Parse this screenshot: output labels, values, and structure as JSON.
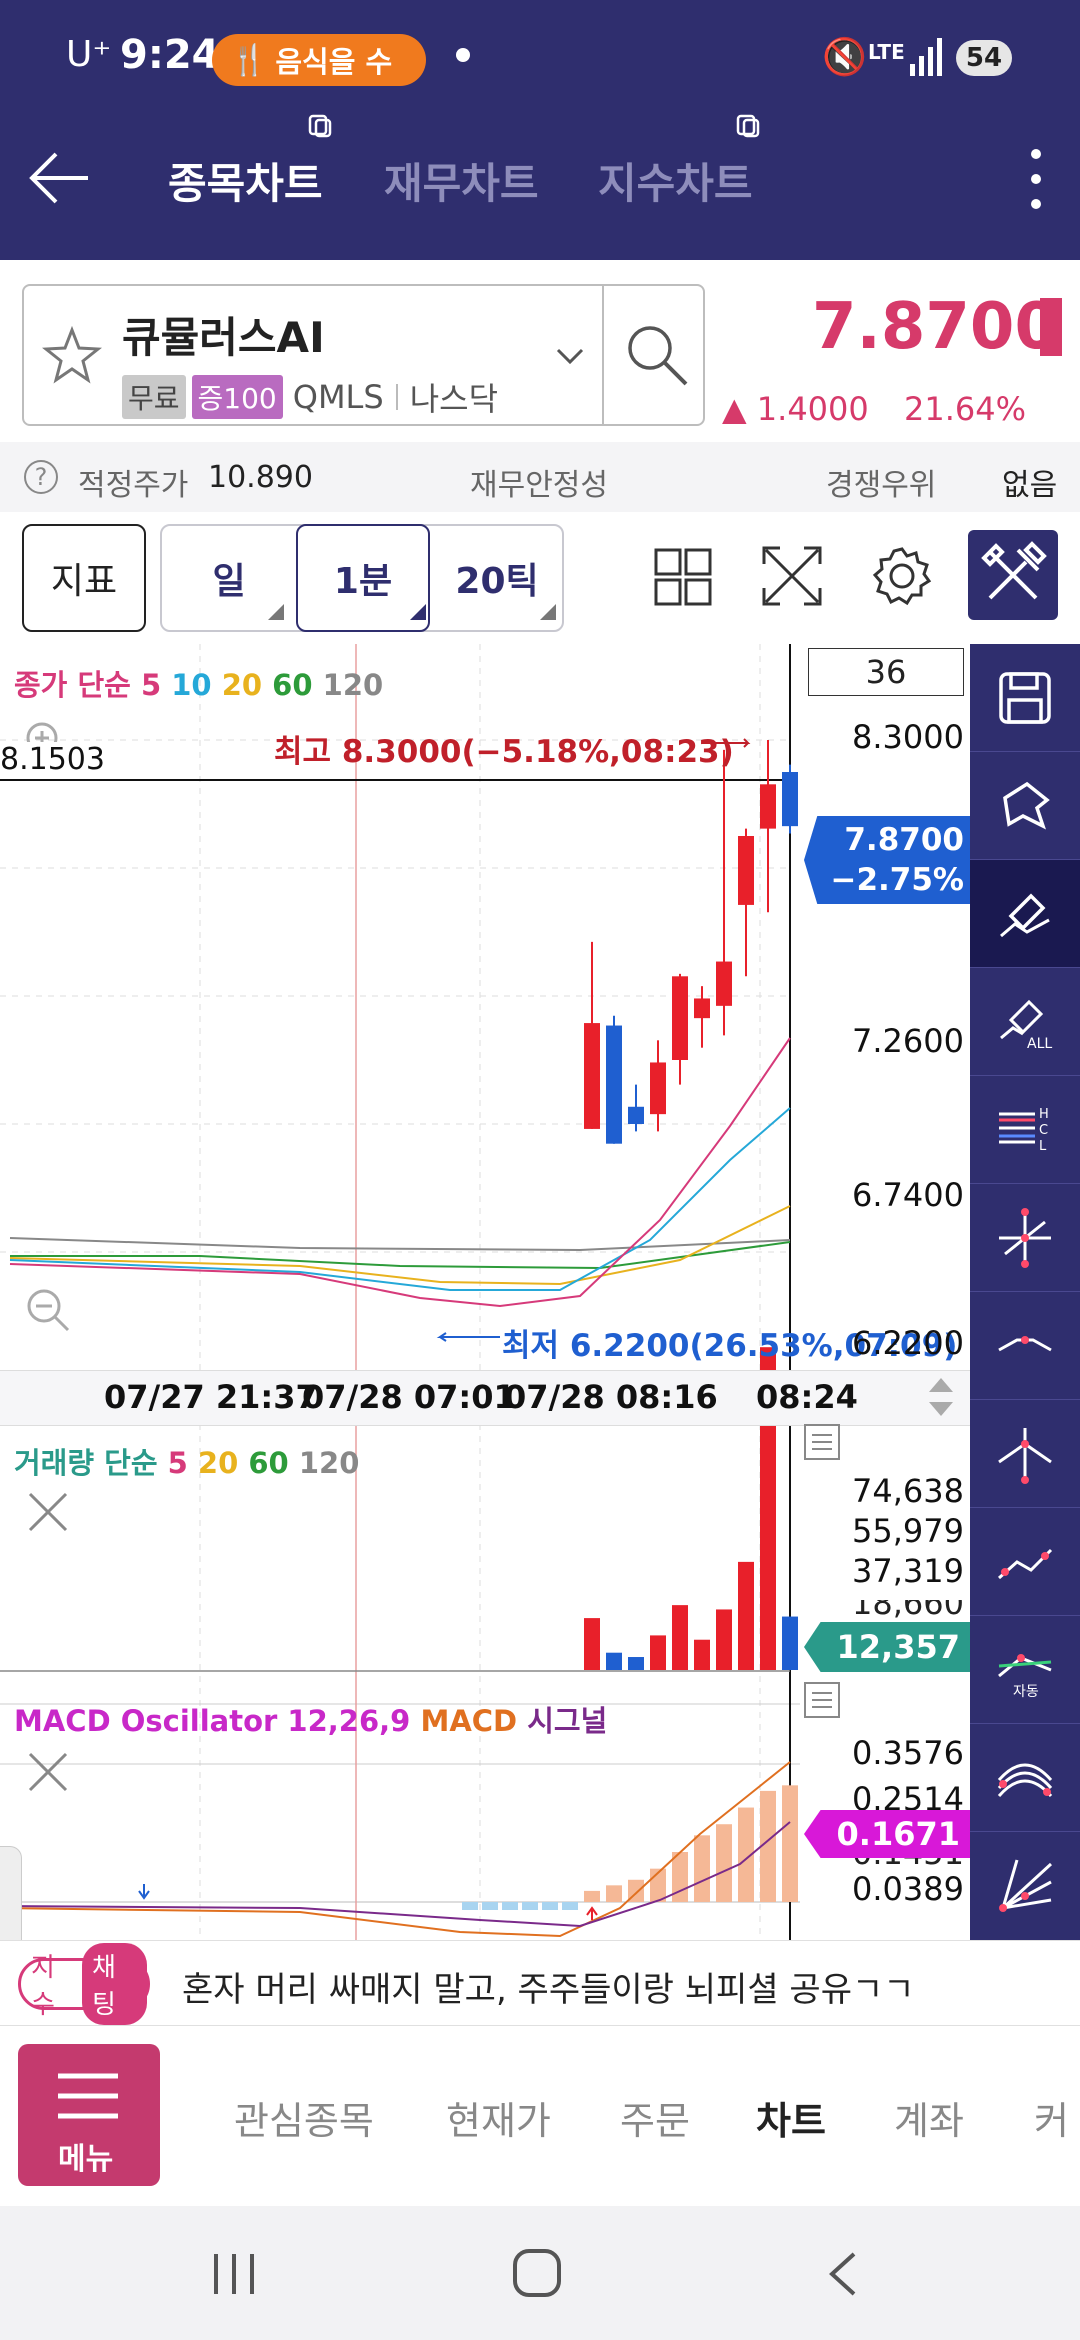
{
  "status_bar": {
    "carrier": "U⁺",
    "time": "9:24",
    "notification": "음식을 수",
    "network": "LTE",
    "battery": "54"
  },
  "header": {
    "tabs": [
      "종목차트",
      "재무차트",
      "지수차트"
    ],
    "active_tab": "종목차트"
  },
  "stock": {
    "name": "큐뮬러스AI",
    "badges": [
      "무료",
      "증100"
    ],
    "ticker": "QMLS",
    "market": "나스닥",
    "price": "7.8700",
    "change": "▲ 1.4000",
    "change_pct": "21.64%"
  },
  "info_row": {
    "fair_price_label": "적정주가",
    "fair_price_value": "10.890",
    "stability_label": "재무안정성",
    "competition_label": "경쟁우위",
    "competition_value": "없음"
  },
  "toolbar": {
    "indicator_btn": "지표",
    "period_buttons": [
      "일",
      "1분",
      "20틱"
    ]
  },
  "main_chart": {
    "legend_prefix": "종가 단순",
    "legend_ma": [
      "5",
      "10",
      "20",
      "60",
      "120"
    ],
    "count_box": "36",
    "crosshair_value": "8.1503",
    "high_annotation": "최고 8.3000(−5.18%,08:23)",
    "low_annotation": "최저 6.2200(26.53%,07:09)",
    "y_ticks": [
      "8.3000",
      "7.2600",
      "6.7400",
      "6.2200"
    ],
    "current_price": "7.8700",
    "current_pct": "−2.75%",
    "x_labels": [
      "07/27 21:37",
      "07/28 07:01",
      "07/28 08:16",
      "08:24"
    ]
  },
  "volume_chart": {
    "legend_prefix": "거래량 단순",
    "legend_ma": [
      "5",
      "20",
      "60",
      "120"
    ],
    "y_ticks": [
      "74,638",
      "55,979",
      "37,319",
      "18,660"
    ],
    "current_volume": "12,357"
  },
  "macd_chart": {
    "legend_osc": "MACD Oscillator 12,26,9",
    "legend_macd": "MACD",
    "legend_signal": "시그널",
    "y_ticks": [
      "0.3576",
      "0.2514",
      "0.1451",
      "0.0389"
    ],
    "current": "0.1671"
  },
  "ticker_bar": {
    "badge_left": "지수",
    "badge_right": "채팅",
    "message": "혼자 머리 싸매지 말고, 주주들이랑 뇌피셜 공유ㄱㄱ"
  },
  "bottom_nav": {
    "menu_label": "메뉴",
    "items": [
      "관심종목",
      "현재가",
      "주문",
      "차트",
      "계좌",
      "커"
    ],
    "active": "차트"
  },
  "colors": {
    "header_bg": "#2f2e6e",
    "up": "#e8202a",
    "down": "#1f5fd0",
    "accent_pink": "#d63a7a",
    "tool_panel": "#2f2e6e"
  },
  "chart_data": {
    "type": "candlestick",
    "ylim": [
      6.22,
      8.3
    ],
    "candles": [
      {
        "open": 7.15,
        "high": 7.48,
        "low": 6.72,
        "close": 6.72,
        "up": true
      },
      {
        "open": 7.14,
        "high": 7.18,
        "low": 6.66,
        "close": 6.66,
        "up": false
      },
      {
        "open": 6.81,
        "high": 6.9,
        "low": 6.71,
        "close": 6.74,
        "up": false
      },
      {
        "open": 6.78,
        "high": 7.08,
        "low": 6.71,
        "close": 6.99,
        "up": true
      },
      {
        "open": 7.0,
        "high": 7.35,
        "low": 6.9,
        "close": 7.34,
        "up": true
      },
      {
        "open": 7.17,
        "high": 7.3,
        "low": 7.05,
        "close": 7.25,
        "up": true
      },
      {
        "open": 7.22,
        "high": 8.26,
        "low": 7.1,
        "close": 7.4,
        "up": true
      },
      {
        "open": 7.63,
        "high": 7.94,
        "low": 7.34,
        "close": 7.91,
        "up": true
      },
      {
        "open": 7.94,
        "high": 8.3,
        "low": 7.6,
        "close": 8.12,
        "up": true
      },
      {
        "open": 8.17,
        "high": 8.2,
        "low": 7.92,
        "close": 7.95,
        "up": false
      }
    ],
    "volume": [
      12000,
      4000,
      3000,
      8000,
      15000,
      7000,
      14000,
      25000,
      74638,
      12357
    ],
    "macd_osc": [
      0.02,
      0.03,
      0.04,
      0.06,
      0.09,
      0.12,
      0.14,
      0.17,
      0.2,
      0.21
    ]
  }
}
